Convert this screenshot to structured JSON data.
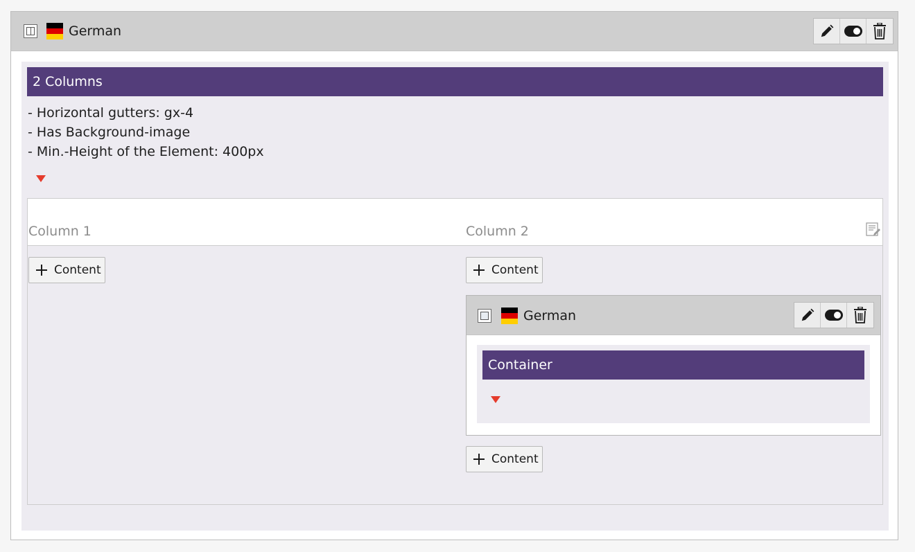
{
  "outer": {
    "language": "German",
    "title": "2 Columns",
    "description": [
      "- Horizontal gutters: gx-4",
      "- Has Background-image",
      "- Min.-Height of the Element: 400px"
    ]
  },
  "columns": [
    {
      "label": "Column 1",
      "add_label": "Content"
    },
    {
      "label": "Column 2",
      "add_label": "Content",
      "add_label_after": "Content"
    }
  ],
  "nested": {
    "language": "German",
    "title": "Container"
  },
  "colors": {
    "header_bg": "#cfcfcf",
    "title_bar": "#533d7a",
    "panel_bg": "#edebf1",
    "toggle_marker": "#e53b2c"
  },
  "icons": {
    "toolbar": [
      "pencil-icon",
      "toggle-icon",
      "trash-icon"
    ],
    "grid": "edit-grid-icon",
    "add": "plus-icon"
  }
}
